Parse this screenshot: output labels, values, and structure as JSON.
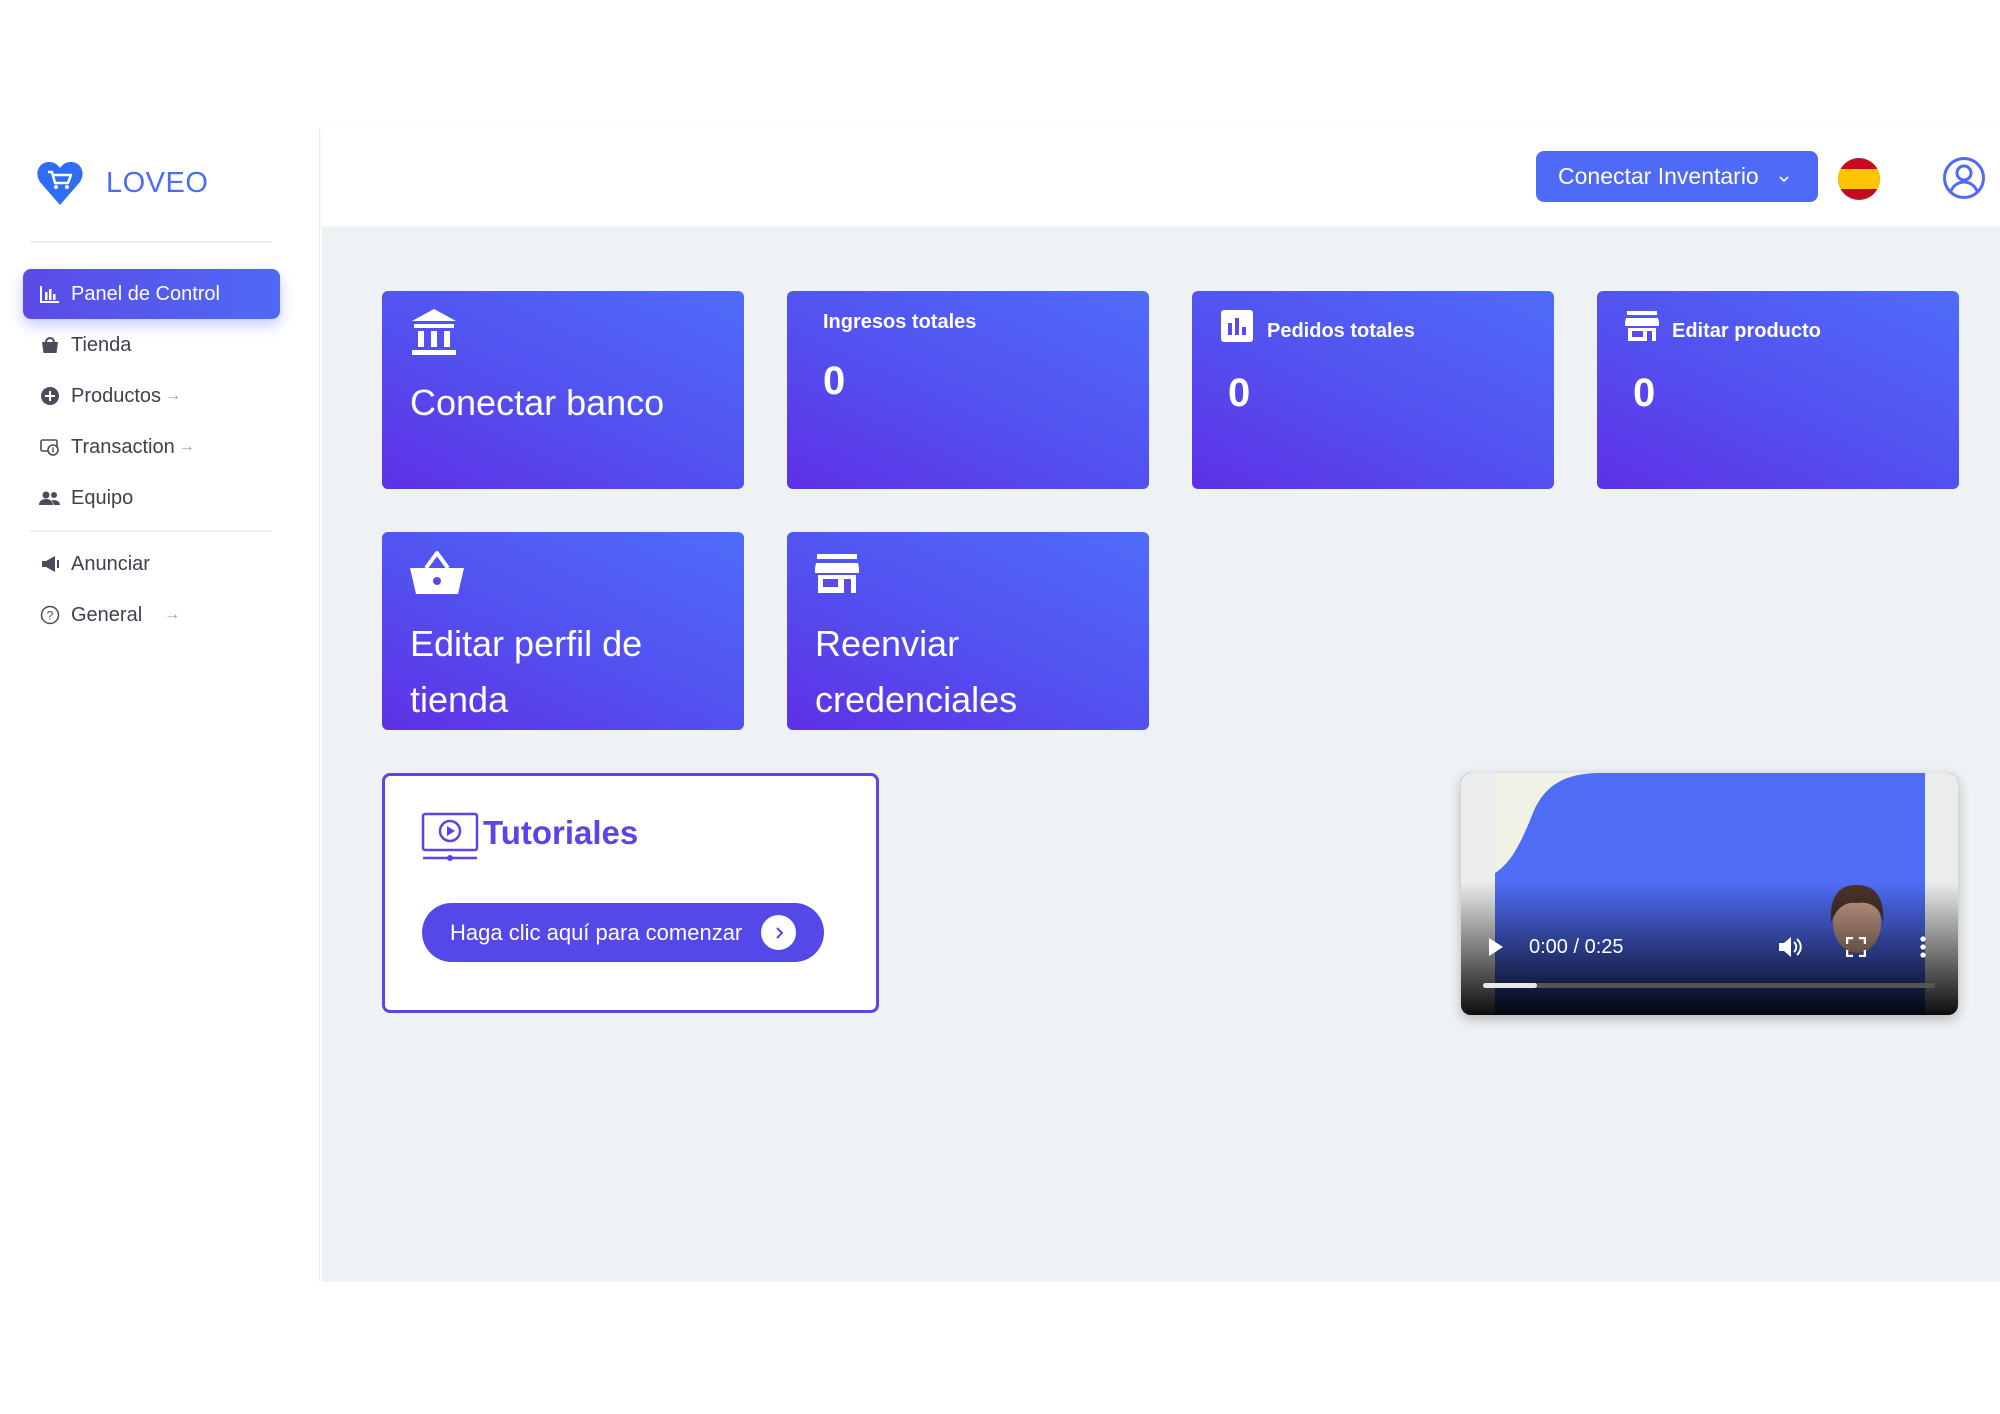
{
  "brand": {
    "name": "LOVEO",
    "color": "#4a6cf7"
  },
  "sidebar": {
    "items": [
      {
        "label": "Panel de Control",
        "icon": "bar-chart-icon",
        "active": true,
        "arrow": ""
      },
      {
        "label": "Tienda",
        "icon": "shopping-bag-icon",
        "active": false,
        "arrow": ""
      },
      {
        "label": "Productos",
        "icon": "plus-circle-icon",
        "active": false,
        "arrow": "→"
      },
      {
        "label": "Transaction",
        "icon": "money-transfer-icon",
        "active": false,
        "arrow": "→"
      },
      {
        "label": "Equipo",
        "icon": "team-icon",
        "active": false,
        "arrow": ""
      },
      {
        "label": "Anunciar",
        "icon": "megaphone-icon",
        "active": false,
        "arrow": ""
      },
      {
        "label": "General",
        "icon": "help-circle-icon",
        "active": false,
        "arrow": "→"
      }
    ]
  },
  "header": {
    "connect_inventory": "Conectar Inventario",
    "language_flag": "spain-flag-icon",
    "profile_icon": "user-circle-icon"
  },
  "cards": {
    "connect_bank": "Conectar banco",
    "total_income": {
      "label": "Ingresos totales",
      "value": "0"
    },
    "total_orders": {
      "label": "Pedidos totales",
      "value": "0"
    },
    "edit_product": {
      "label": "Editar producto",
      "value": "0"
    },
    "edit_store_profile": "Editar perfil de tienda",
    "resend_credentials": "Reenviar credenciales"
  },
  "tutorials": {
    "title": "Tutoriales",
    "cta": "Haga clic aquí para comenzar"
  },
  "video": {
    "time": "0:00 / 0:25",
    "progress": 0.12
  },
  "colors": {
    "accent": "#4f6af7",
    "card_gradient_start": "#5f30e6",
    "card_gradient_end": "#4f6cfa",
    "main_bg": "#eff2f4"
  }
}
